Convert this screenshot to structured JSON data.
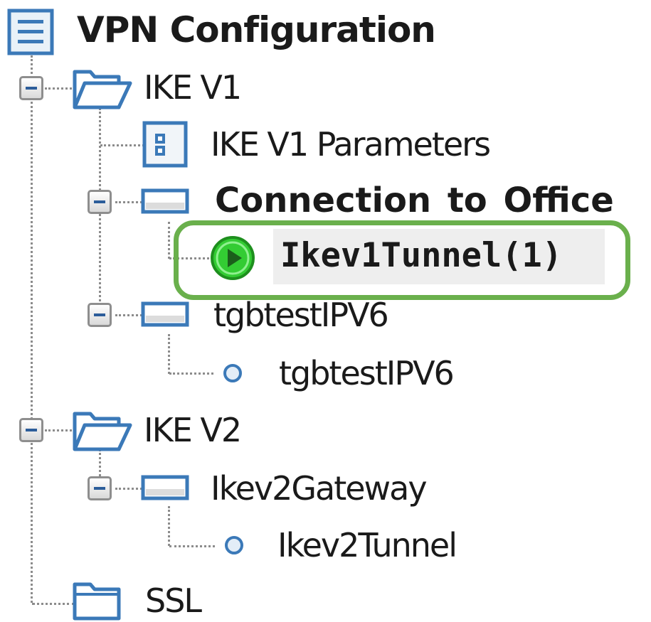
{
  "tree": {
    "root": {
      "label": "VPN Configuration",
      "icon": "list-document-icon"
    },
    "nodes": [
      {
        "label": "IKE V1",
        "icon": "folder-open-icon",
        "expanded": true
      },
      {
        "label": "IKE V1 Parameters",
        "icon": "parameters-icon"
      },
      {
        "label": "Connection  to  Office",
        "icon": "gateway-icon",
        "expanded": true
      },
      {
        "label": "Ikev1Tunnel(1)",
        "icon": "tunnel-active-icon",
        "status": "active",
        "selected": true
      },
      {
        "label": "tgbtestIPV6",
        "icon": "gateway-icon",
        "expanded": true
      },
      {
        "label": "tgbtestIPV6",
        "icon": "tunnel-inactive-icon",
        "status": "inactive"
      },
      {
        "label": "IKE V2",
        "icon": "folder-open-icon",
        "expanded": true
      },
      {
        "label": "Ikev2Gateway",
        "icon": "gateway-icon",
        "expanded": true
      },
      {
        "label": "Ikev2Tunnel",
        "icon": "tunnel-inactive-icon",
        "status": "inactive"
      },
      {
        "label": "SSL",
        "icon": "folder-closed-icon",
        "expanded": false
      }
    ],
    "highlight_color": "#6ab04c",
    "active_color": "#33cc33",
    "inactive_color": "#3b79b8"
  }
}
